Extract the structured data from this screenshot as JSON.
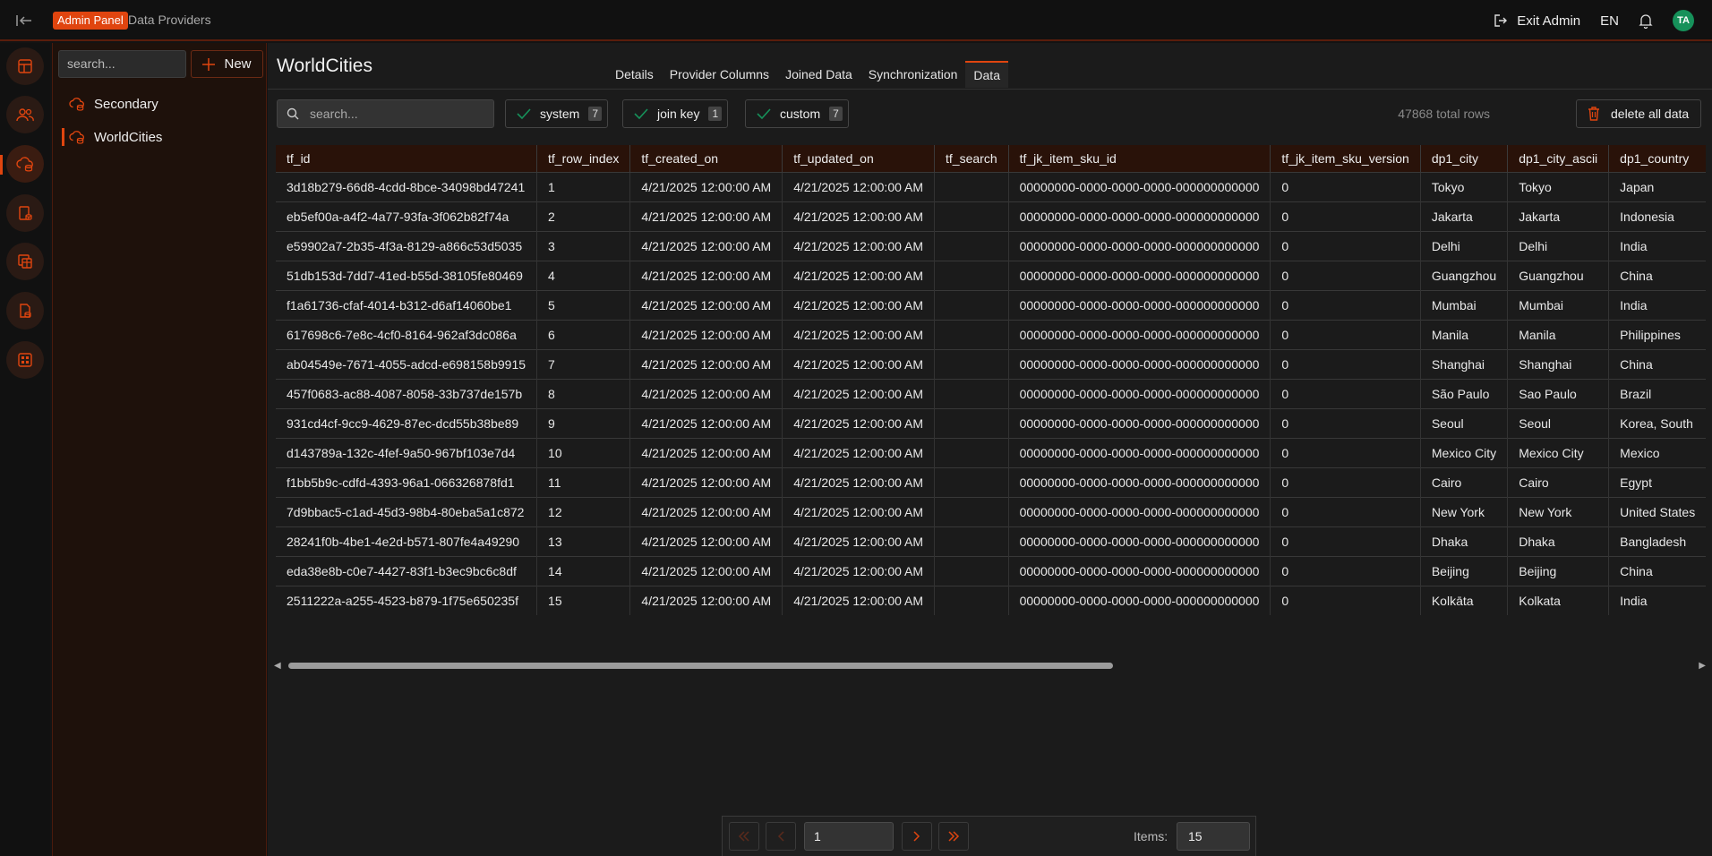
{
  "header": {
    "badge": "Admin Panel",
    "breadcrumb": "Data Providers",
    "exit_label": "Exit Admin",
    "language": "EN",
    "avatar_initials": "TA"
  },
  "colors": {
    "accent": "#e0450f",
    "avatar": "#16915a"
  },
  "rail": {
    "items": [
      "layout-icon",
      "users-icon",
      "cloud-data-icon",
      "database-icon",
      "tables-icon",
      "file-data-icon",
      "grid-icon"
    ],
    "active_index": 2
  },
  "sidebar": {
    "search_placeholder": "search...",
    "new_label": "New",
    "items": [
      {
        "label": "Secondary"
      },
      {
        "label": "WorldCities",
        "active": true
      }
    ]
  },
  "main": {
    "title": "WorldCities",
    "tabs": [
      "Details",
      "Provider Columns",
      "Joined Data",
      "Synchronization",
      "Data"
    ],
    "active_tab": "Data",
    "search_placeholder": "search...",
    "filters": [
      {
        "label": "system",
        "count": "7"
      },
      {
        "label": "join key",
        "count": "1"
      },
      {
        "label": "custom",
        "count": "7"
      }
    ],
    "total_rows": "47868 total rows",
    "delete_label": "delete all data"
  },
  "table": {
    "columns": [
      "tf_id",
      "tf_row_index",
      "tf_created_on",
      "tf_updated_on",
      "tf_search",
      "tf_jk_item_sku_id",
      "tf_jk_item_sku_version",
      "dp1_city",
      "dp1_city_ascii",
      "dp1_country"
    ],
    "rows": [
      [
        "3d18b279-66d8-4cdd-8bce-34098bd47241",
        "1",
        "4/21/2025 12:00:00 AM",
        "4/21/2025 12:00:00 AM",
        "",
        "00000000-0000-0000-0000-000000000000",
        "0",
        "Tokyo",
        "Tokyo",
        "Japan"
      ],
      [
        "eb5ef00a-a4f2-4a77-93fa-3f062b82f74a",
        "2",
        "4/21/2025 12:00:00 AM",
        "4/21/2025 12:00:00 AM",
        "",
        "00000000-0000-0000-0000-000000000000",
        "0",
        "Jakarta",
        "Jakarta",
        "Indonesia"
      ],
      [
        "e59902a7-2b35-4f3a-8129-a866c53d5035",
        "3",
        "4/21/2025 12:00:00 AM",
        "4/21/2025 12:00:00 AM",
        "",
        "00000000-0000-0000-0000-000000000000",
        "0",
        "Delhi",
        "Delhi",
        "India"
      ],
      [
        "51db153d-7dd7-41ed-b55d-38105fe80469",
        "4",
        "4/21/2025 12:00:00 AM",
        "4/21/2025 12:00:00 AM",
        "",
        "00000000-0000-0000-0000-000000000000",
        "0",
        "Guangzhou",
        "Guangzhou",
        "China"
      ],
      [
        "f1a61736-cfaf-4014-b312-d6af14060be1",
        "5",
        "4/21/2025 12:00:00 AM",
        "4/21/2025 12:00:00 AM",
        "",
        "00000000-0000-0000-0000-000000000000",
        "0",
        "Mumbai",
        "Mumbai",
        "India"
      ],
      [
        "617698c6-7e8c-4cf0-8164-962af3dc086a",
        "6",
        "4/21/2025 12:00:00 AM",
        "4/21/2025 12:00:00 AM",
        "",
        "00000000-0000-0000-0000-000000000000",
        "0",
        "Manila",
        "Manila",
        "Philippines"
      ],
      [
        "ab04549e-7671-4055-adcd-e698158b9915",
        "7",
        "4/21/2025 12:00:00 AM",
        "4/21/2025 12:00:00 AM",
        "",
        "00000000-0000-0000-0000-000000000000",
        "0",
        "Shanghai",
        "Shanghai",
        "China"
      ],
      [
        "457f0683-ac88-4087-8058-33b737de157b",
        "8",
        "4/21/2025 12:00:00 AM",
        "4/21/2025 12:00:00 AM",
        "",
        "00000000-0000-0000-0000-000000000000",
        "0",
        "São Paulo",
        "Sao Paulo",
        "Brazil"
      ],
      [
        "931cd4cf-9cc9-4629-87ec-dcd55b38be89",
        "9",
        "4/21/2025 12:00:00 AM",
        "4/21/2025 12:00:00 AM",
        "",
        "00000000-0000-0000-0000-000000000000",
        "0",
        "Seoul",
        "Seoul",
        "Korea, South"
      ],
      [
        "d143789a-132c-4fef-9a50-967bf103e7d4",
        "10",
        "4/21/2025 12:00:00 AM",
        "4/21/2025 12:00:00 AM",
        "",
        "00000000-0000-0000-0000-000000000000",
        "0",
        "Mexico City",
        "Mexico City",
        "Mexico"
      ],
      [
        "f1bb5b9c-cdfd-4393-96a1-066326878fd1",
        "11",
        "4/21/2025 12:00:00 AM",
        "4/21/2025 12:00:00 AM",
        "",
        "00000000-0000-0000-0000-000000000000",
        "0",
        "Cairo",
        "Cairo",
        "Egypt"
      ],
      [
        "7d9bbac5-c1ad-45d3-98b4-80eba5a1c872",
        "12",
        "4/21/2025 12:00:00 AM",
        "4/21/2025 12:00:00 AM",
        "",
        "00000000-0000-0000-0000-000000000000",
        "0",
        "New York",
        "New York",
        "United States"
      ],
      [
        "28241f0b-4be1-4e2d-b571-807fe4a49290",
        "13",
        "4/21/2025 12:00:00 AM",
        "4/21/2025 12:00:00 AM",
        "",
        "00000000-0000-0000-0000-000000000000",
        "0",
        "Dhaka",
        "Dhaka",
        "Bangladesh"
      ],
      [
        "eda38e8b-c0e7-4427-83f1-b3ec9bc6c8df",
        "14",
        "4/21/2025 12:00:00 AM",
        "4/21/2025 12:00:00 AM",
        "",
        "00000000-0000-0000-0000-000000000000",
        "0",
        "Beijing",
        "Beijing",
        "China"
      ],
      [
        "2511222a-a255-4523-b879-1f75e650235f",
        "15",
        "4/21/2025 12:00:00 AM",
        "4/21/2025 12:00:00 AM",
        "",
        "00000000-0000-0000-0000-000000000000",
        "0",
        "Kolkāta",
        "Kolkata",
        "India"
      ]
    ]
  },
  "pagination": {
    "page": "1",
    "items_label": "Items:",
    "items_per_page": "15"
  }
}
